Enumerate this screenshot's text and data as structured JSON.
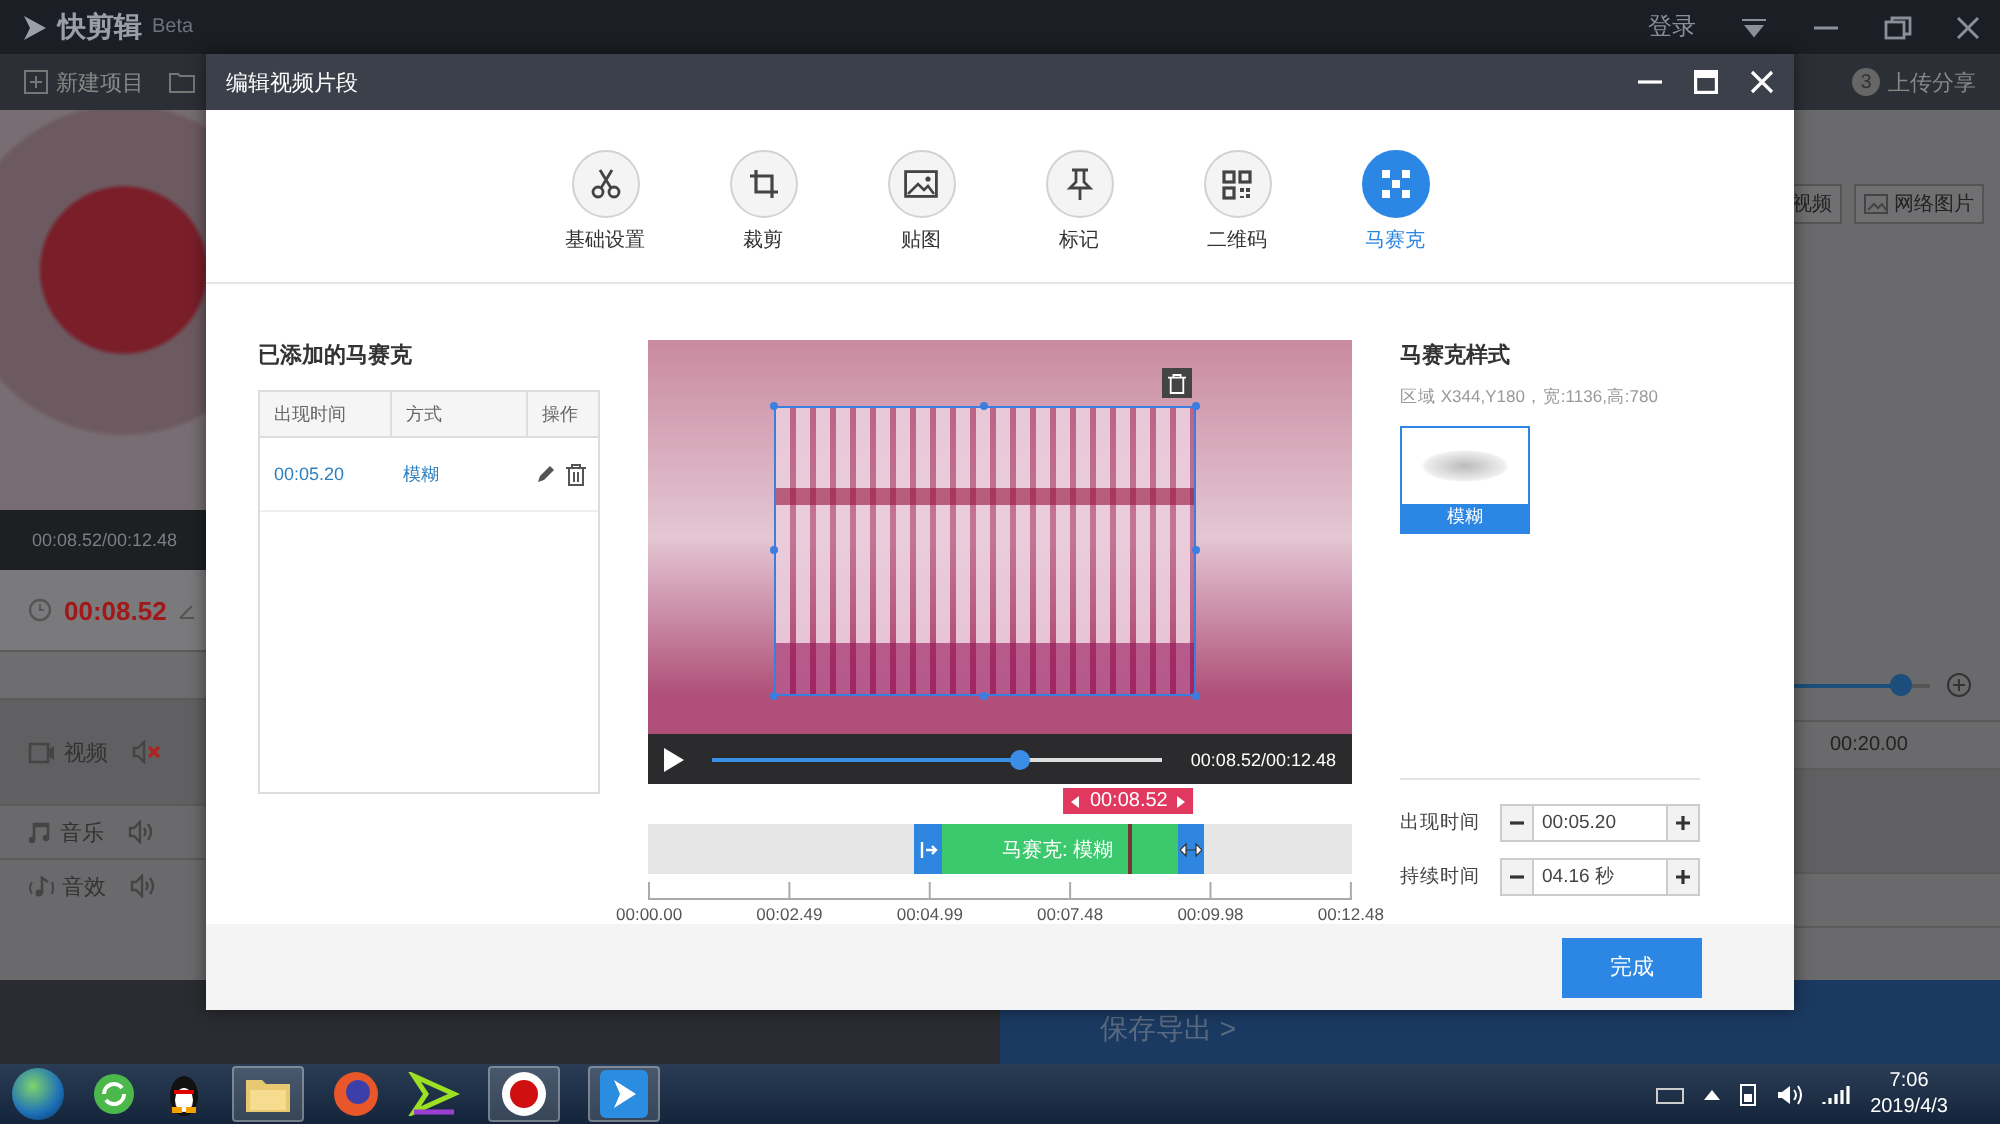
{
  "app": {
    "title": "快剪辑",
    "badge": "Beta",
    "login": "登录",
    "toolbar": [
      {
        "label": "新建项目"
      }
    ],
    "step": {
      "number": "3",
      "label": "上传分享"
    },
    "media_buttons": [
      {
        "label": "视频"
      },
      {
        "label": "网络图片"
      }
    ],
    "preview_time": "00:08.52/00:12.48",
    "current_time": "00:08.52",
    "zoom_slider": {
      "level": 0.8
    },
    "ruler_tick": "00:20.00",
    "tracks": [
      {
        "name": "视频",
        "kind": "video",
        "muted": true
      },
      {
        "name": "音乐",
        "kind": "music",
        "muted": false
      },
      {
        "name": "音效",
        "kind": "effect",
        "muted": false
      }
    ],
    "export": "保存导出 >"
  },
  "dialog": {
    "title": "编辑视频片段",
    "tabs": [
      {
        "label": "基础设置",
        "kind": "scissors",
        "selected": false
      },
      {
        "label": "裁剪",
        "kind": "crop",
        "selected": false
      },
      {
        "label": "贴图",
        "kind": "image",
        "selected": false
      },
      {
        "label": "标记",
        "kind": "pin",
        "selected": false
      },
      {
        "label": "二维码",
        "kind": "qr",
        "selected": false
      },
      {
        "label": "马赛克",
        "kind": "mosaic",
        "selected": true
      }
    ],
    "list": {
      "title": "已添加的马赛克",
      "columns": [
        "出现时间",
        "方式",
        "操作"
      ],
      "rows": [
        {
          "time": "00:05.20",
          "mode": "模糊"
        }
      ]
    },
    "player": {
      "time": "00:08.52/00:12.48",
      "level": 0.683,
      "marker": "00:08.52"
    },
    "clip": {
      "label": "马赛克: 模糊"
    },
    "ruler": [
      "00:00.00",
      "00:02.49",
      "00:04.99",
      "00:07.48",
      "00:09.98",
      "00:12.48"
    ],
    "style": {
      "title": "马赛克样式",
      "region": "区域 X344,Y180，宽:1136,高:780",
      "options": [
        {
          "label": "模糊",
          "selected": true
        }
      ]
    },
    "fields": [
      {
        "label": "出现时间",
        "value": "00:05.20"
      },
      {
        "label": "持续时间",
        "value": "04.16 秒"
      }
    ],
    "done": "完成"
  },
  "taskbar": {
    "time": "7:06",
    "date": "2019/4/3"
  }
}
